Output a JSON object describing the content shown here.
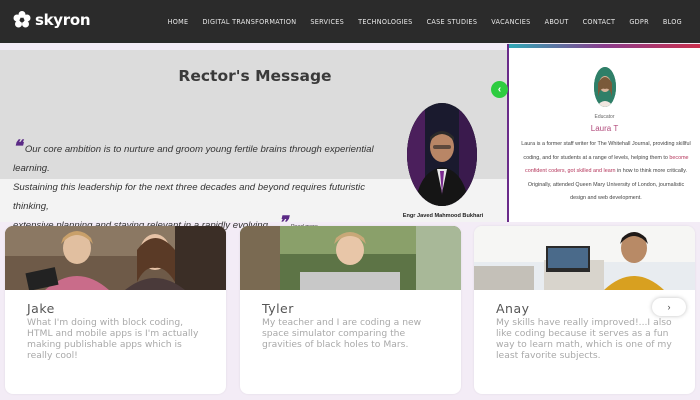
{
  "brand": {
    "name": "skyron"
  },
  "nav": {
    "items": [
      {
        "label": "HOME"
      },
      {
        "label": "DIGITAL TRANSFORMATION"
      },
      {
        "label": "SERVICES"
      },
      {
        "label": "TECHNOLOGIES"
      },
      {
        "label": "CASE STUDIES"
      },
      {
        "label": "VACANCIES"
      },
      {
        "label": "ABOUT"
      },
      {
        "label": "CONTACT"
      },
      {
        "label": "GDPR"
      },
      {
        "label": "BLOG"
      }
    ]
  },
  "rector": {
    "title": "Rector's Message",
    "quote_line1": "Our core ambition is to nurture and groom young fertile brains through experiential learning.",
    "quote_line2": "Sustaining this leadership for the next three decades and beyond requires futuristic thinking,",
    "quote_line3": "extensive planning and staying relevant in a rapidly evolving...",
    "read_more": "Read more",
    "open_quote": "❝",
    "close_quote": "❞",
    "caption": "Engr Javed Mahmood Bukhari"
  },
  "testimonial_panel": {
    "role": "Educator",
    "name": "Laura T",
    "text_part1": "Laura is a former staff writer for The Whitehall Journal, providing skillful coding, and for students at a range of levels, helping them to ",
    "text_highlight": "become confident coders, got skilled and learn",
    "text_part2": " in how to think more critically. Originally, attended Queen Mary University of London, journalistic design and web development.",
    "slider_icon": "‹"
  },
  "cards": [
    {
      "name": "Jake",
      "text": "What I'm doing with block coding, HTML and mobile apps is I'm actually making publishable apps which is really cool!"
    },
    {
      "name": "Tyler",
      "text": "My teacher and I are coding a new space simulator comparing the gravities of black holes to Mars."
    },
    {
      "name": "Anay",
      "text": "My skills have really improved!...I also like coding because it serves as a fun way to learn math, which is one of my least favorite subjects."
    }
  ],
  "carousel": {
    "next_icon": "›"
  },
  "colors": {
    "nav_bg": "#2b2b2b",
    "accent_purple": "#6a2b8a",
    "slider_green": "#2ecc40",
    "highlight": "#b5375c"
  }
}
